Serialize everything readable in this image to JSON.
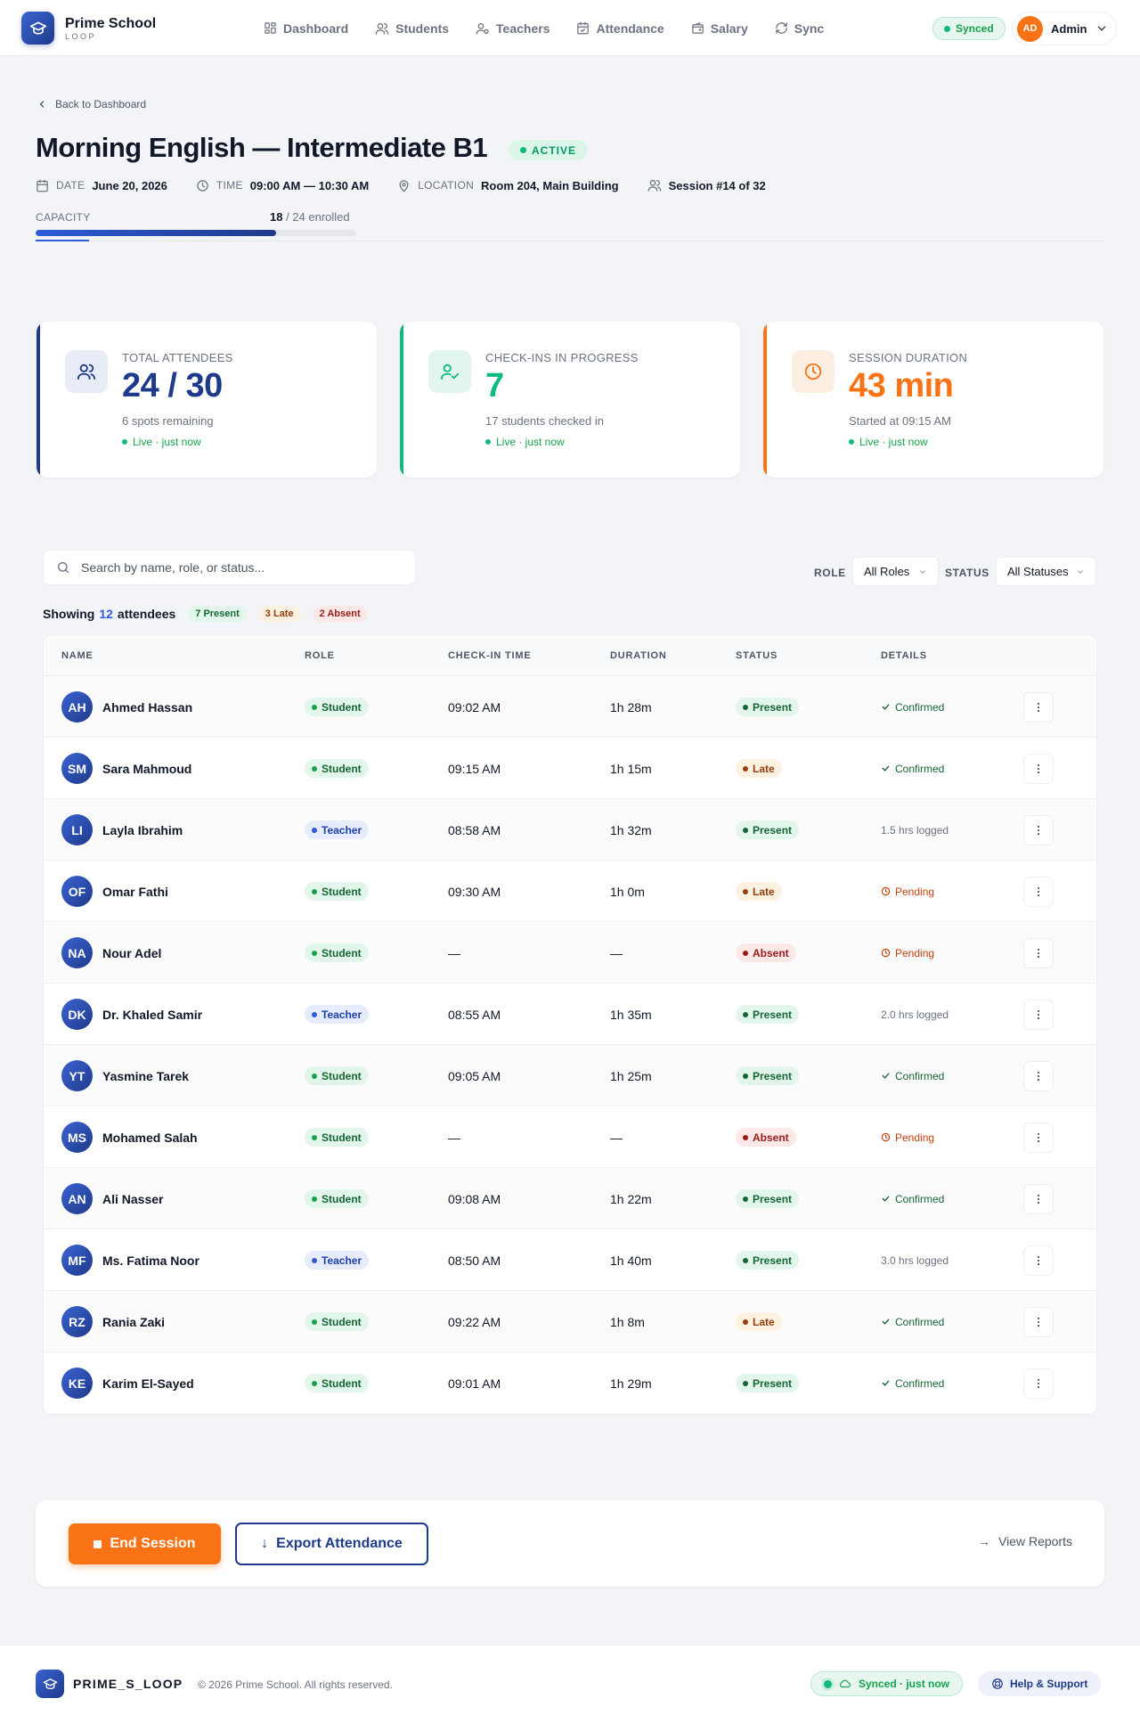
{
  "brand": {
    "name": "Prime School",
    "sub": "LOOP"
  },
  "nav": [
    {
      "label": "Dashboard",
      "icon": "grid-icon"
    },
    {
      "label": "Students",
      "icon": "users-icon"
    },
    {
      "label": "Teachers",
      "icon": "user-check-icon"
    },
    {
      "label": "Attendance",
      "icon": "calendar-icon"
    },
    {
      "label": "Salary",
      "icon": "wallet-icon"
    },
    {
      "label": "Sync",
      "icon": "refresh-icon"
    }
  ],
  "sync_status": "Synced",
  "user": {
    "initials": "AD",
    "name": "Admin"
  },
  "back_link": "Back to Dashboard",
  "session": {
    "title": "Morning English — Intermediate B1",
    "status": "ACTIVE",
    "date_label": "DATE",
    "date": "June 20, 2026",
    "time_label": "TIME",
    "time": "09:00 AM — 10:30 AM",
    "location_label": "LOCATION",
    "location": "Room 204, Main Building",
    "session_no": "Session #14 of 32",
    "capacity_label": "CAPACITY",
    "enrolled": "18",
    "capacity_text": "/ 24 enrolled",
    "capacity_fraction": 0.75
  },
  "stats": [
    {
      "label": "TOTAL ATTENDEES",
      "value": "24 / 30",
      "sub": "6 spots remaining",
      "live": "Live · just now",
      "color": "#1e3a8a",
      "icon": "users-icon"
    },
    {
      "label": "CHECK-INS IN PROGRESS",
      "value": "7",
      "sub": "17 students checked in",
      "live": "Live · just now",
      "color": "#10b981",
      "icon": "user-check-icon"
    },
    {
      "label": "SESSION DURATION",
      "value": "43 min",
      "sub": "Started at 09:15 AM",
      "live": "Live · just now",
      "color": "#f97316",
      "icon": "clock-icon"
    }
  ],
  "filters": {
    "search_placeholder": "Search by name, role, or status...",
    "role_label": "ROLE",
    "role_value": "All Roles",
    "status_label": "STATUS",
    "status_value": "All Statuses"
  },
  "summary": {
    "prefix": "Showing",
    "count": "12",
    "suffix": "attendees",
    "present": "7 Present",
    "late": "3 Late",
    "absent": "2 Absent"
  },
  "table": {
    "headers": [
      "NAME",
      "ROLE",
      "CHECK-IN TIME",
      "DURATION",
      "STATUS",
      "DETAILS"
    ],
    "rows": [
      {
        "initials": "AH",
        "name": "Ahmed Hassan",
        "role": "Student",
        "checkin": "09:02 AM",
        "duration": "1h 28m",
        "status": "Present",
        "detail": "Confirmed",
        "detail_type": "confirmed"
      },
      {
        "initials": "SM",
        "name": "Sara Mahmoud",
        "role": "Student",
        "checkin": "09:15 AM",
        "duration": "1h 15m",
        "status": "Late",
        "detail": "Confirmed",
        "detail_type": "confirmed"
      },
      {
        "initials": "LI",
        "name": "Layla Ibrahim",
        "role": "Teacher",
        "checkin": "08:58 AM",
        "duration": "1h 32m",
        "status": "Present",
        "detail": "1.5 hrs logged",
        "detail_type": "logged"
      },
      {
        "initials": "OF",
        "name": "Omar Fathi",
        "role": "Student",
        "checkin": "09:30 AM",
        "duration": "1h 0m",
        "status": "Late",
        "detail": "Pending",
        "detail_type": "pending"
      },
      {
        "initials": "NA",
        "name": "Nour Adel",
        "role": "Student",
        "checkin": "—",
        "duration": "—",
        "status": "Absent",
        "detail": "Pending",
        "detail_type": "pending"
      },
      {
        "initials": "DK",
        "name": "Dr. Khaled Samir",
        "role": "Teacher",
        "checkin": "08:55 AM",
        "duration": "1h 35m",
        "status": "Present",
        "detail": "2.0 hrs logged",
        "detail_type": "logged"
      },
      {
        "initials": "YT",
        "name": "Yasmine Tarek",
        "role": "Student",
        "checkin": "09:05 AM",
        "duration": "1h 25m",
        "status": "Present",
        "detail": "Confirmed",
        "detail_type": "confirmed"
      },
      {
        "initials": "MS",
        "name": "Mohamed Salah",
        "role": "Student",
        "checkin": "—",
        "duration": "—",
        "status": "Absent",
        "detail": "Pending",
        "detail_type": "pending"
      },
      {
        "initials": "AN",
        "name": "Ali Nasser",
        "role": "Student",
        "checkin": "09:08 AM",
        "duration": "1h 22m",
        "status": "Present",
        "detail": "Confirmed",
        "detail_type": "confirmed"
      },
      {
        "initials": "MF",
        "name": "Ms. Fatima Noor",
        "role": "Teacher",
        "checkin": "08:50 AM",
        "duration": "1h 40m",
        "status": "Present",
        "detail": "3.0 hrs logged",
        "detail_type": "logged"
      },
      {
        "initials": "RZ",
        "name": "Rania Zaki",
        "role": "Student",
        "checkin": "09:22 AM",
        "duration": "1h 8m",
        "status": "Late",
        "detail": "Confirmed",
        "detail_type": "confirmed"
      },
      {
        "initials": "KE",
        "name": "Karim El-Sayed",
        "role": "Student",
        "checkin": "09:01 AM",
        "duration": "1h 29m",
        "status": "Present",
        "detail": "Confirmed",
        "detail_type": "confirmed"
      }
    ]
  },
  "actions": {
    "end_session": "End Session",
    "export": "Export Attendance",
    "export_arrow": "↓",
    "view_reports": "View Reports",
    "view_reports_arrow": "→"
  },
  "footer": {
    "brand": "PRIME_S_LOOP",
    "copyright": "© 2026 Prime School. All rights reserved.",
    "synced": "Synced · just now",
    "help": "Help & Support"
  },
  "colors": {
    "primary": "#1e3a8a",
    "accent_blue": "#2f5bd8",
    "green": "#10b981",
    "orange": "#f97316"
  }
}
